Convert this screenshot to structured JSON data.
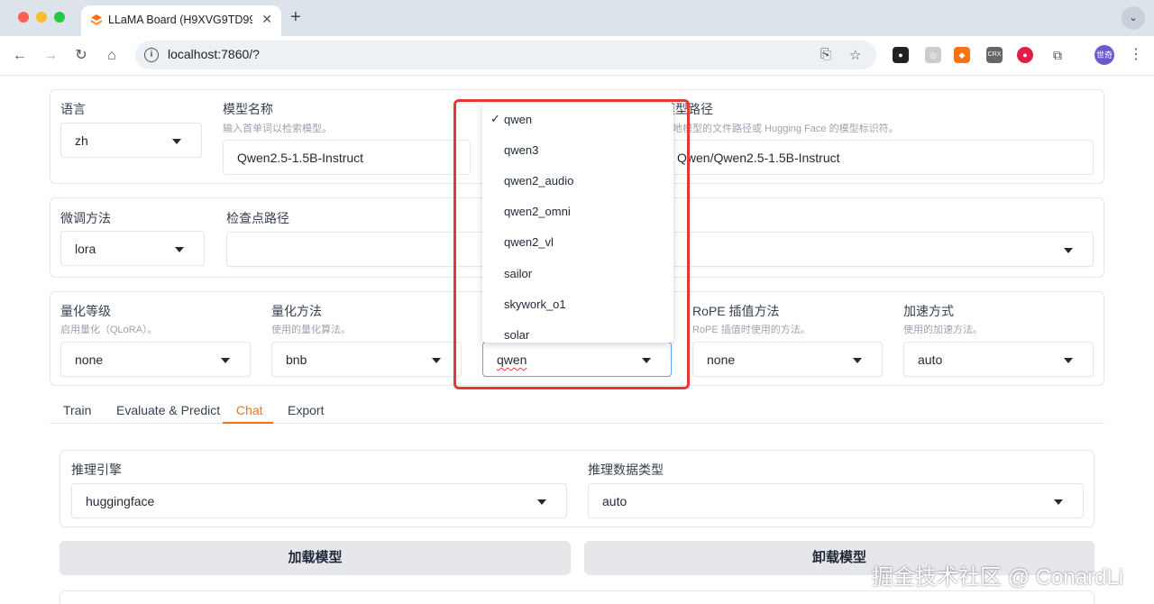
{
  "browser": {
    "tab_title": "LLaMA Board (H9XVG9TD99",
    "url": "localhost:7860/?"
  },
  "top": {
    "lang_label": "语言",
    "lang_value": "zh",
    "model_name_label": "模型名称",
    "model_name_info": "输入首单词以检索模型。",
    "model_name_value": "Qwen2.5-1.5B-Instruct",
    "model_path_label": "模型路径",
    "model_path_info": "本地模型的文件路径或 Hugging Face 的模型标识符。",
    "model_path_value": "Qwen/Qwen2.5-1.5B-Instruct"
  },
  "finetune": {
    "method_label": "微调方法",
    "method_value": "lora",
    "checkpoint_label": "检查点路径"
  },
  "advanced": {
    "quant_bit_label": "量化等级",
    "quant_bit_info": "启用量化（QLoRA）。",
    "quant_bit_value": "none",
    "quant_method_label": "量化方法",
    "quant_method_info": "使用的量化算法。",
    "quant_method_value": "bnb",
    "template_value": "qwen",
    "rope_label": "RoPE 插值方法",
    "rope_info": "RoPE 插值时使用的方法。",
    "rope_value": "none",
    "booster_label": "加速方式",
    "booster_info": "使用的加速方法。",
    "booster_value": "auto"
  },
  "dropdown": {
    "check": "✓",
    "options": [
      "qwen",
      "qwen3",
      "qwen2_audio",
      "qwen2_omni",
      "qwen2_vl",
      "sailor",
      "skywork_o1",
      "solar"
    ]
  },
  "tabs": [
    "Train",
    "Evaluate & Predict",
    "Chat",
    "Export"
  ],
  "chat": {
    "engine_label": "推理引擎",
    "engine_value": "huggingface",
    "dtype_label": "推理数据类型",
    "dtype_value": "auto",
    "load_button": "加载模型",
    "unload_button": "卸载模型"
  },
  "watermark": "掘金技术社区 @ ConardLi"
}
